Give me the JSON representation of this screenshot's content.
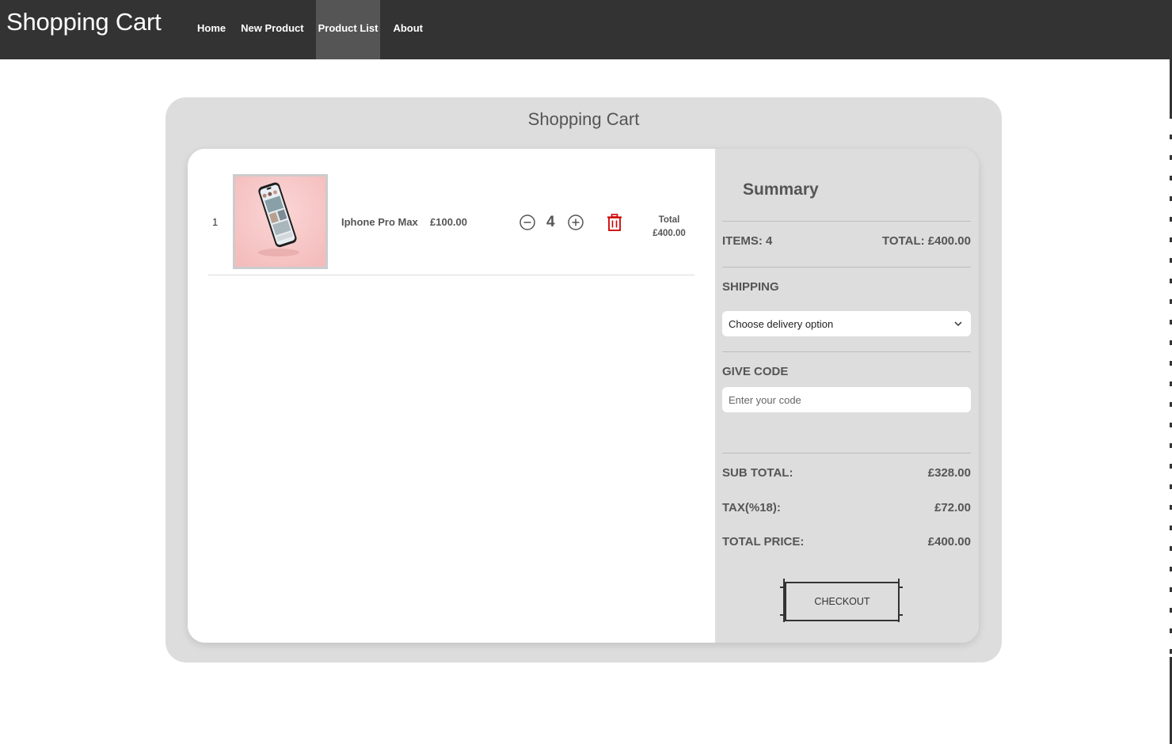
{
  "navbar": {
    "brand": "Shopping Cart",
    "items": [
      {
        "label": "Home",
        "active": false
      },
      {
        "label": "New Product",
        "active": false
      },
      {
        "label": "Product List",
        "active": true
      },
      {
        "label": "About",
        "active": false
      }
    ]
  },
  "page": {
    "title": "Shopping Cart"
  },
  "cart": {
    "items": [
      {
        "index": "1",
        "name": "Iphone Pro Max",
        "price": "£100.00",
        "quantity": "4",
        "total_label": "Total",
        "total": "£400.00"
      }
    ]
  },
  "summary": {
    "title": "Summary",
    "items_label": "ITEMS: 4",
    "total_label": "TOTAL: £400.00",
    "shipping_title": "SHIPPING",
    "shipping_select": "Choose delivery option",
    "code_title": "GIVE CODE",
    "code_placeholder": "Enter your code",
    "subtotal_label": "SUB TOTAL:",
    "subtotal_value": "£328.00",
    "tax_label": "TAX(%18):",
    "tax_value": "£72.00",
    "total_price_label": "TOTAL PRICE:",
    "total_price_value": "£400.00",
    "checkout_label": "CHECKOUT"
  },
  "colors": {
    "navbar": "#333333",
    "nav_active": "#555555",
    "card": "#dddddd",
    "delete": "#cc0000"
  }
}
